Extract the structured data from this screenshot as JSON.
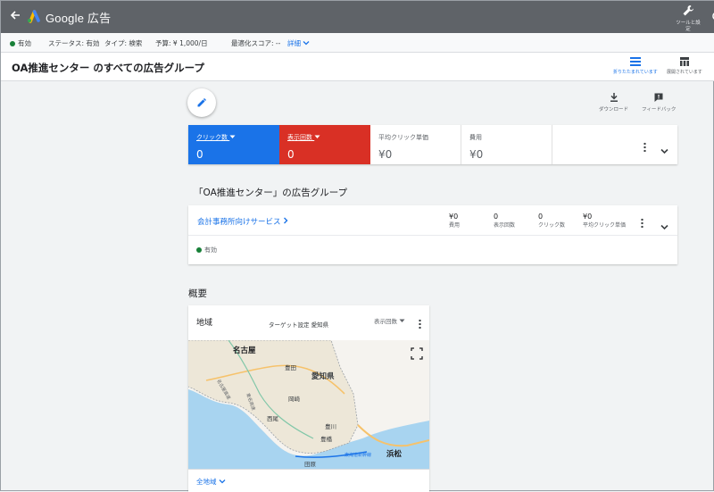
{
  "app": {
    "brand": "Google 広告",
    "tools_label": "ツールと設定"
  },
  "status": {
    "state": "有効",
    "status_text": "ステータス: 有効",
    "type_text": "タイプ: 検索",
    "budget_text": "予算: ¥ 1,000/日",
    "score_text": "最適化スコア: --",
    "details_link": "詳細"
  },
  "title": {
    "text": "OA推進センター のすべての広告グループ",
    "view_collapsed": "折りたたまれています",
    "view_expanded": "展開されています"
  },
  "actions": {
    "download": "ダウンロード",
    "feedback": "フィードバック"
  },
  "metrics": [
    {
      "label": "クリック数",
      "value": "0"
    },
    {
      "label": "表示回数",
      "value": "0"
    },
    {
      "label": "平均クリック単価",
      "value": "¥0"
    },
    {
      "label": "費用",
      "value": "¥0"
    }
  ],
  "adgroups": {
    "section_title": "「OA推進センター」の広告グループ",
    "name": "会計事務所向けサービス",
    "status": "有効",
    "stats": [
      {
        "value": "¥0",
        "label": "費用"
      },
      {
        "value": "0",
        "label": "表示回数"
      },
      {
        "value": "0",
        "label": "クリック数"
      },
      {
        "value": "¥0",
        "label": "平均クリック単価"
      }
    ]
  },
  "overview": {
    "title": "概要",
    "region_title": "地域",
    "target_text": "ターゲット設定 愛知県",
    "metric_dropdown": "表示回数",
    "footer": "全地域",
    "map_labels": {
      "nagoya": "名古屋",
      "aichi": "愛知県",
      "toyota": "豊田",
      "okazaki": "岡崎",
      "nishio": "西尾",
      "toyokawa": "豊川",
      "toyohashi": "豊橋",
      "hamamatsu": "浜松",
      "tahara": "田原",
      "highway1": "名古屋高速",
      "highway2": "東名高速",
      "shinkansen": "東海道新幹線"
    }
  },
  "colors": {
    "accent": "#1a73e8",
    "clicks_bg": "#1a73e8",
    "impressions_bg": "#d93025",
    "topbar": "#5f6368",
    "active_status": "#188038"
  }
}
